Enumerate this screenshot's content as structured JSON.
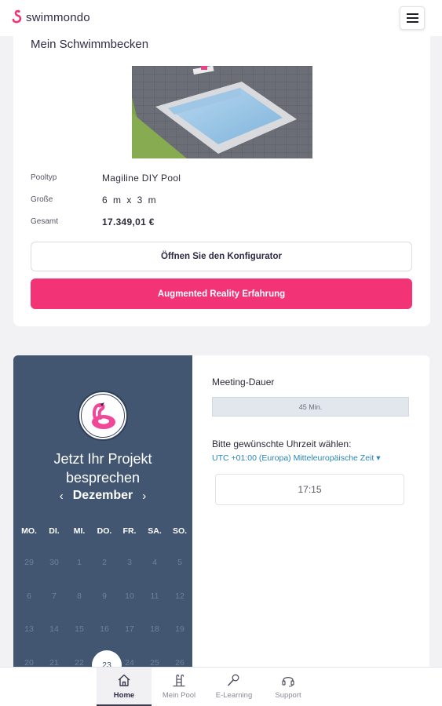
{
  "header": {
    "logo_text": "swimmondo"
  },
  "pool": {
    "title": "Mein Schwimmbecken",
    "specs": [
      {
        "label": "Pooltyp",
        "value": "Magiline DIY Pool"
      },
      {
        "label": "Große",
        "value": "6 m x 3 m"
      },
      {
        "label": "Gesamt",
        "value": "17.349,01 €"
      }
    ],
    "configurator_label": "Öffnen Sie den Konfigurator",
    "ar_label": "Augmented Reality Erfahrung",
    "accent_color": "#f23477"
  },
  "meeting": {
    "calendar": {
      "heading_line1": "Jetzt Ihr Projekt",
      "heading_line2": "besprechen",
      "month": "Dezember",
      "weekdays": [
        "MO.",
        "DI.",
        "MI.",
        "DO.",
        "FR.",
        "SA.",
        "SO."
      ],
      "days": [
        "29",
        "30",
        "1",
        "2",
        "3",
        "4",
        "5",
        "6",
        "7",
        "8",
        "9",
        "10",
        "11",
        "12",
        "13",
        "14",
        "15",
        "16",
        "17",
        "18",
        "19",
        "20",
        "21",
        "22",
        "",
        "24",
        "25",
        "26"
      ],
      "selected_day": "23",
      "panel_color": "#425671"
    },
    "duration_label": "Meeting-Dauer",
    "duration_value": "45 Min.",
    "time_label": "Bitte gewünschte Uhrzeit wählen:",
    "timezone": "UTC +01:00 (Europa) Mitteleuropäische Zeit ▾",
    "time_slot": "17:15"
  },
  "nav": {
    "items": [
      {
        "label": "Home",
        "icon": "home-icon",
        "active": true
      },
      {
        "label": "Mein Pool",
        "icon": "pool-ladder-icon",
        "active": false
      },
      {
        "label": "E-Learning",
        "icon": "e-learning-icon",
        "active": false
      },
      {
        "label": "Support",
        "icon": "headset-icon",
        "active": false
      }
    ]
  }
}
